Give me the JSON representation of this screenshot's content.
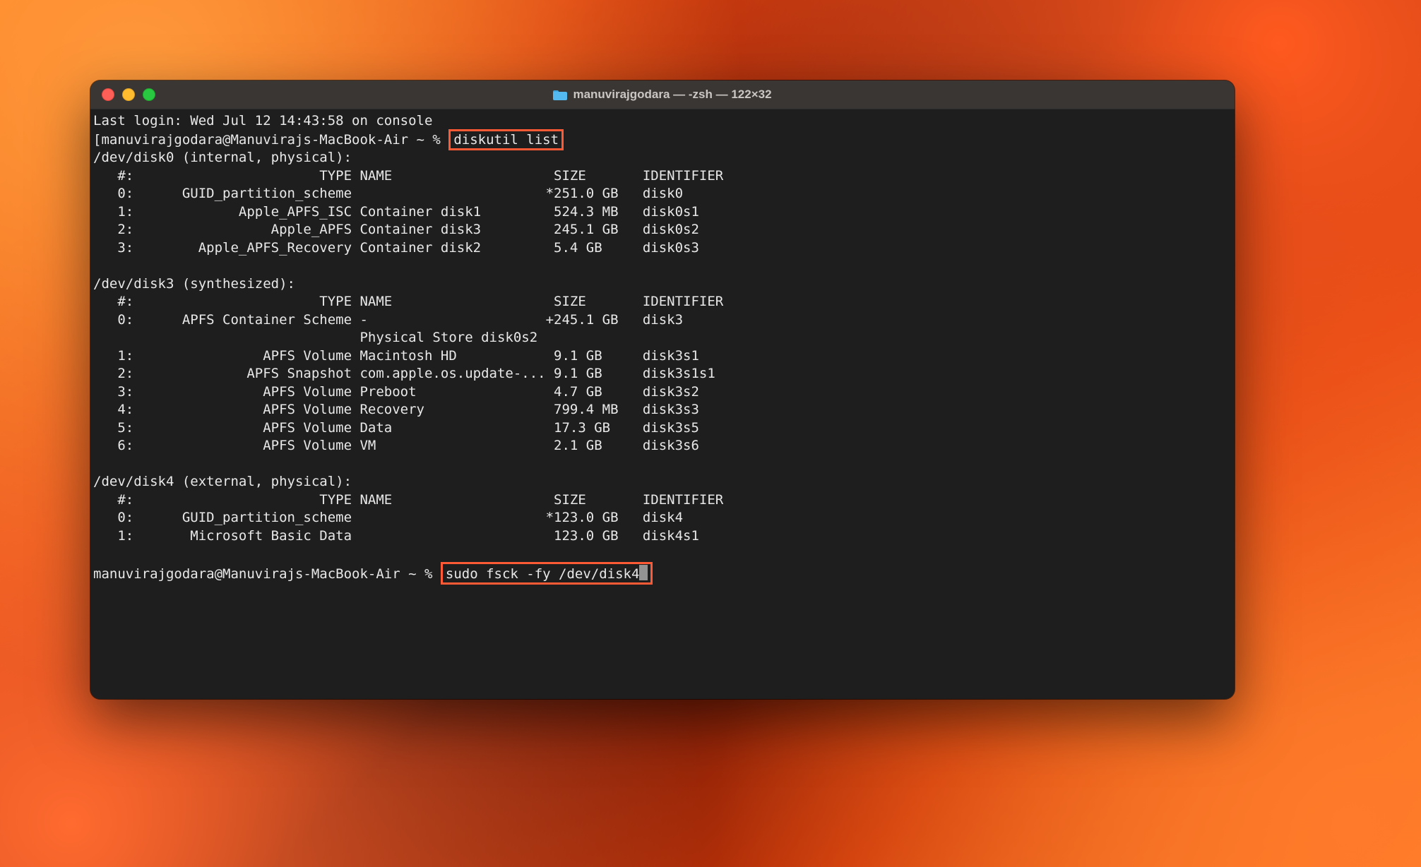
{
  "window": {
    "title": "manuvirajgodara — -zsh — 122×32"
  },
  "terminal": {
    "last_login": "Last login: Wed Jul 12 14:43:58 on console",
    "prompt1_prefix": "[manuvirajgodara@Manuvirajs-MacBook-Air ~ % ",
    "cmd1": "diskutil list",
    "disk0_header": "/dev/disk0 (internal, physical):",
    "col_header": "   #:                       TYPE NAME                    SIZE       IDENTIFIER",
    "d0r0": "   0:      GUID_partition_scheme                        *251.0 GB   disk0",
    "d0r1": "   1:             Apple_APFS_ISC Container disk1         524.3 MB   disk0s1",
    "d0r2": "   2:                 Apple_APFS Container disk3         245.1 GB   disk0s2",
    "d0r3": "   3:        Apple_APFS_Recovery Container disk2         5.4 GB     disk0s3",
    "disk3_header": "/dev/disk3 (synthesized):",
    "d3r0": "   0:      APFS Container Scheme -                      +245.1 GB   disk3",
    "d3rphys": "                                 Physical Store disk0s2",
    "d3r1": "   1:                APFS Volume Macintosh HD            9.1 GB     disk3s1",
    "d3r2": "   2:              APFS Snapshot com.apple.os.update-... 9.1 GB     disk3s1s1",
    "d3r3": "   3:                APFS Volume Preboot                 4.7 GB     disk3s2",
    "d3r4": "   4:                APFS Volume Recovery                799.4 MB   disk3s3",
    "d3r5": "   5:                APFS Volume Data                    17.3 GB    disk3s5",
    "d3r6": "   6:                APFS Volume VM                      2.1 GB     disk3s6",
    "disk4_header": "/dev/disk4 (external, physical):",
    "d4r0": "   0:      GUID_partition_scheme                        *123.0 GB   disk4",
    "d4r1": "   1:       Microsoft Basic Data                         123.0 GB   disk4s1",
    "prompt2_prefix": "manuvirajgodara@Manuvirajs-MacBook-Air ~ % ",
    "cmd2": "sudo fsck -fy /dev/disk4"
  }
}
